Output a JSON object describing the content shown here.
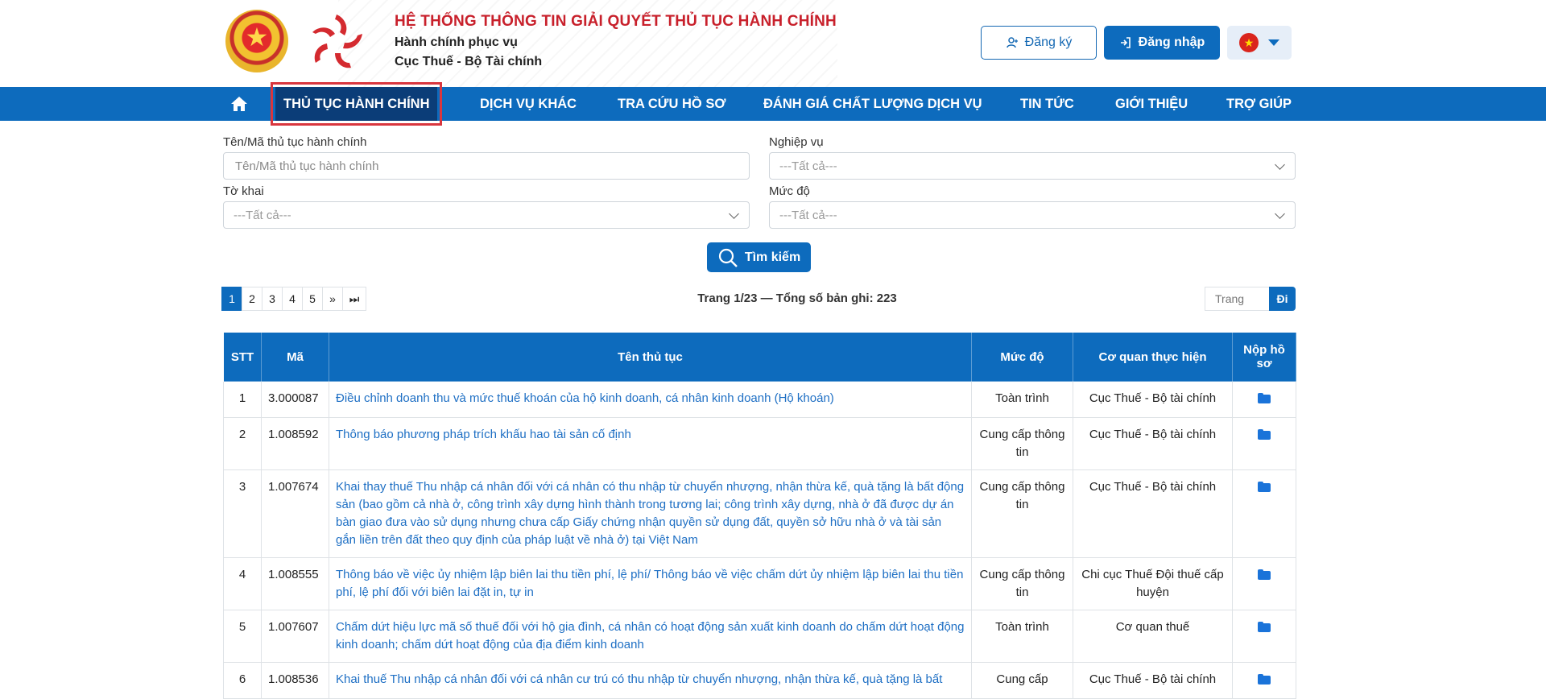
{
  "header": {
    "system_title": "HỆ THỐNG THÔNG TIN GIẢI QUYẾT THỦ TỤC HÀNH CHÍNH",
    "subtitle1": "Hành chính phục vụ",
    "subtitle2": "Cục Thuế - Bộ Tài chính",
    "register_label": "Đăng ký",
    "login_label": "Đăng nhập",
    "language_flag": "vietnam-flag-icon"
  },
  "nav": {
    "items": [
      {
        "label": "THỦ TỤC HÀNH CHÍNH"
      },
      {
        "label": "DỊCH VỤ KHÁC"
      },
      {
        "label": "TRA CỨU HỒ SƠ"
      },
      {
        "label": "ĐÁNH GIÁ CHẤT LƯỢNG DỊCH VỤ"
      },
      {
        "label": "TIN TỨC"
      },
      {
        "label": "GIỚI THIỆU"
      },
      {
        "label": "TRỢ GIÚP"
      }
    ]
  },
  "filters": {
    "name_label": "Tên/Mã thủ tục hành chính",
    "name_placeholder": "Tên/Mã thủ tục hành chính",
    "business_label": "Nghiệp vụ",
    "business_value": "---Tất cả---",
    "form_label": "Tờ khai",
    "form_value": "---Tất cả---",
    "level_label": "Mức độ",
    "level_value": "---Tất cả---",
    "search_label": "Tìm kiếm"
  },
  "pagination": {
    "pages": [
      "1",
      "2",
      "3",
      "4",
      "5",
      "»",
      "⏭"
    ],
    "info": "Trang 1/23 — Tổng số bản ghi: 223",
    "goto_placeholder": "Trang",
    "goto_label": "Đi"
  },
  "table": {
    "headers": [
      "STT",
      "Mã",
      "Tên thủ tục",
      "Mức độ",
      "Cơ quan thực hiện",
      "Nộp hồ sơ"
    ],
    "rows": [
      {
        "stt": "1",
        "code": "3.000087",
        "name": "Điều chỉnh doanh thu và mức thuế khoán của hộ kinh doanh, cá nhân kinh doanh (Hộ khoán)",
        "level": "Toàn trình",
        "agency": "Cục Thuế - Bộ tài chính"
      },
      {
        "stt": "2",
        "code": "1.008592",
        "name": "Thông báo phương pháp trích khấu hao tài sản cố định",
        "level": "Cung cấp thông tin",
        "agency": "Cục Thuế - Bộ tài chính"
      },
      {
        "stt": "3",
        "code": "1.007674",
        "name": "Khai thay thuế Thu nhập cá nhân đối với cá nhân có thu nhập từ chuyển nhượng, nhận thừa kế, quà tặng là bất động sản (bao gồm cả nhà ở, công trình xây dựng hình thành trong tương lai; công trình xây dựng, nhà ở đã được dự án bàn giao đưa vào sử dụng nhưng chưa cấp Giấy chứng nhận quyền sử dụng đất, quyền sở hữu nhà ở và tài sản gắn liền trên đất theo quy định của pháp luật về nhà ở) tại Việt Nam",
        "level": "Cung cấp thông tin",
        "agency": "Cục Thuế - Bộ tài chính"
      },
      {
        "stt": "4",
        "code": "1.008555",
        "name": "Thông báo về việc ủy nhiệm lập biên lai thu tiền phí, lệ phí/ Thông báo về việc chấm dứt ủy nhiệm lập biên lai thu tiền phí, lệ phí đối với biên lai đặt in, tự in",
        "level": "Cung cấp thông tin",
        "agency": "Chi cục Thuế Đội thuế cấp huyện"
      },
      {
        "stt": "5",
        "code": "1.007607",
        "name": "Chấm dứt hiệu lực mã số thuế đối với hộ gia đình, cá nhân có hoạt động sản xuất kinh doanh do chấm dứt hoạt động kinh doanh; chấm dứt hoạt động của địa điểm kinh doanh",
        "level": "Toàn trình",
        "agency": "Cơ quan thuế"
      },
      {
        "stt": "6",
        "code": "1.008536",
        "name": "Khai thuế Thu nhập cá nhân đối với cá nhân cư trú có thu nhập từ chuyển nhượng, nhận thừa kế, quà tặng là bất",
        "level": "Cung cấp",
        "agency": "Cục Thuế - Bộ tài chính"
      }
    ]
  },
  "colors": {
    "primary": "#0d6bbd",
    "nav_active": "#0b3d78",
    "title_red": "#c8202b",
    "highlight_border": "#d9363e",
    "link": "#1e6fc4"
  }
}
